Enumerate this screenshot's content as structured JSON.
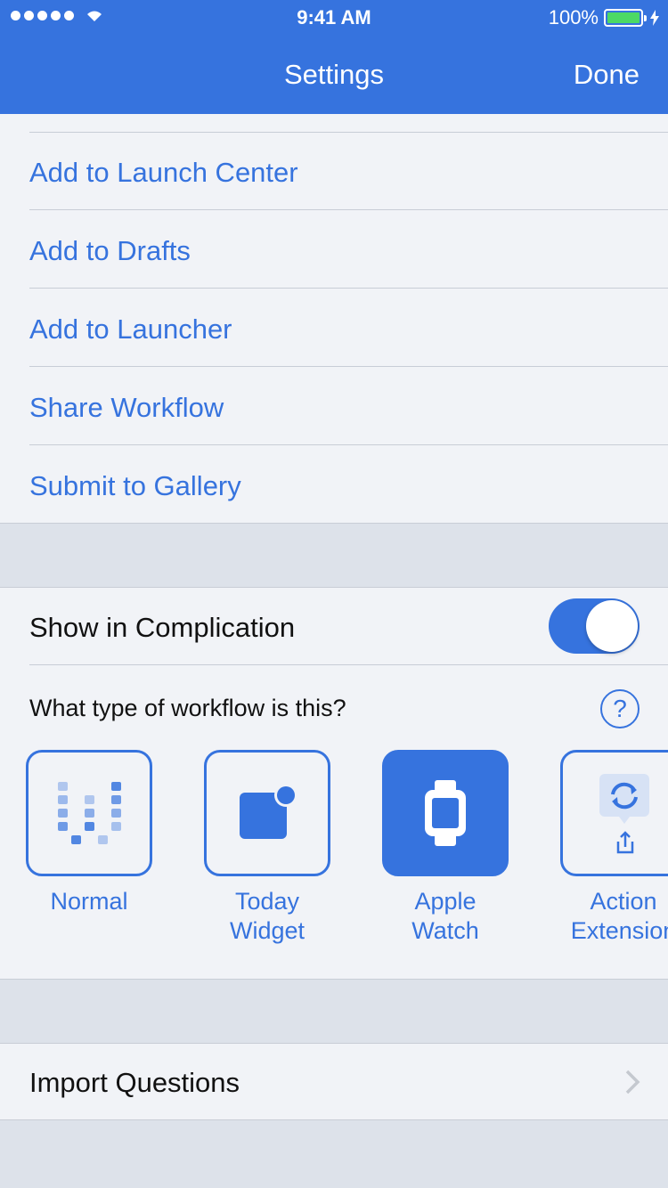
{
  "status_bar": {
    "time": "9:41 AM",
    "battery_text": "100%"
  },
  "nav": {
    "title": "Settings",
    "done_label": "Done"
  },
  "actions": [
    {
      "label": "Add to Launch Center"
    },
    {
      "label": "Add to Drafts"
    },
    {
      "label": "Add to Launcher"
    },
    {
      "label": "Share Workflow"
    },
    {
      "label": "Submit to Gallery"
    }
  ],
  "complication": {
    "label": "Show in Complication",
    "enabled": true
  },
  "workflow_type": {
    "question": "What type of workflow is this?",
    "help_symbol": "?",
    "options": [
      {
        "label_line1": "Normal",
        "label_line2": "",
        "icon": "normal-grid-icon",
        "selected": false
      },
      {
        "label_line1": "Today",
        "label_line2": "Widget",
        "icon": "today-widget-icon",
        "selected": false
      },
      {
        "label_line1": "Apple",
        "label_line2": "Watch",
        "icon": "apple-watch-icon",
        "selected": true
      },
      {
        "label_line1": "Action",
        "label_line2": "Extension",
        "icon": "action-extension-icon",
        "selected": false
      }
    ]
  },
  "import_questions": {
    "label": "Import Questions"
  },
  "colors": {
    "accent": "#3673de",
    "background": "#dde2ea",
    "cell": "#f1f3f7"
  }
}
